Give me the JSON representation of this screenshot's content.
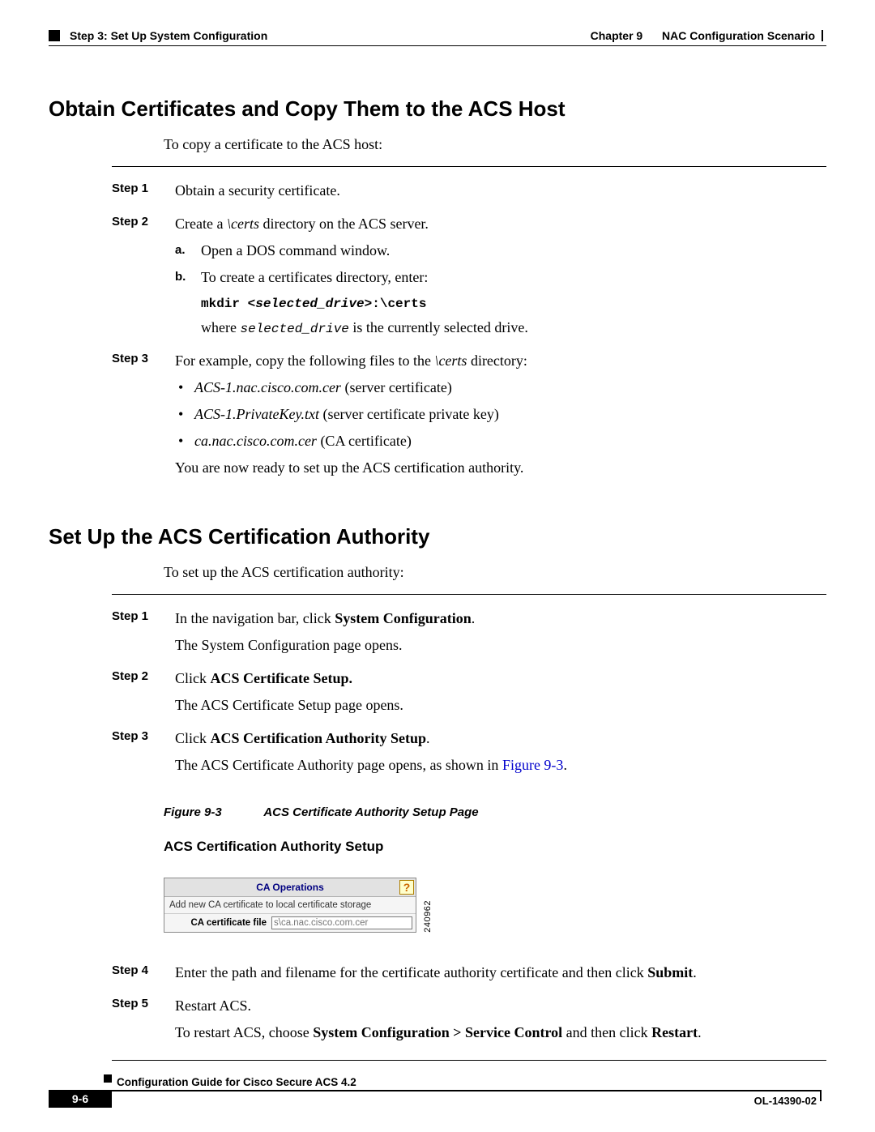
{
  "header": {
    "left": "Step 3: Set Up System Configuration",
    "chapter": "Chapter 9",
    "chapter_title": "NAC Configuration Scenario"
  },
  "section1": {
    "title": "Obtain Certificates and Copy Them to the ACS Host",
    "intro": "To copy a certificate to the ACS host:",
    "step1_label": "Step 1",
    "step1_text": "Obtain a security certificate.",
    "step2_label": "Step 2",
    "step2_text_pre": "Create a ",
    "step2_certs": "\\certs",
    "step2_text_post": " directory on the ACS server.",
    "step2a_letter": "a.",
    "step2a_text": "Open a DOS command window.",
    "step2b_letter": "b.",
    "step2b_text": "To create a certificates directory, enter:",
    "step2b_cmd_pre": "mkdir <",
    "step2b_cmd_it": "selected_drive",
    "step2b_cmd_post": ">:\\certs",
    "step2b_where_pre": "where ",
    "step2b_where_it": "selected_drive",
    "step2b_where_post": " is the currently selected drive.",
    "step3_label": "Step 3",
    "step3_text_pre": "For example, copy the following files to the ",
    "step3_certs": "\\certs",
    "step3_text_post": " directory:",
    "step3_b1_it": "ACS-1.nac.cisco.com.cer",
    "step3_b1_rest": " (server certificate)",
    "step3_b2_it": "ACS-1.PrivateKey.txt",
    "step3_b2_rest": " (server certificate private key)",
    "step3_b3_it": "ca.nac.cisco.com.cer",
    "step3_b3_rest": " (CA certificate)",
    "step3_ready": "You are now ready to set up the ACS certification authority."
  },
  "section2": {
    "title": "Set Up the ACS Certification Authority",
    "intro": "To set up the ACS certification authority:",
    "step1_label": "Step 1",
    "step1_pre": "In the navigation bar, click ",
    "step1_bold": "System Configuration",
    "step1_post": ".",
    "step1_result": "The System Configuration page opens.",
    "step2_label": "Step 2",
    "step2_pre": "Click ",
    "step2_bold": "ACS Certificate Setup.",
    "step2_result": "The ACS Certificate Setup page opens.",
    "step3_label": "Step 3",
    "step3_pre": "Click ",
    "step3_bold": "ACS Certification Authority Setup",
    "step3_post": ".",
    "step3_result_pre": "The ACS Certificate Authority page opens, as shown in ",
    "step3_link": "Figure 9-3",
    "step3_result_post": ".",
    "fig_no": "Figure 9-3",
    "fig_title": "ACS Certificate Authority Setup Page",
    "ui_heading": "ACS Certification Authority Setup",
    "ui_panel_title": "CA Operations",
    "ui_desc": "Add new CA certificate to local certificate storage",
    "ui_field_label": "CA certificate file",
    "ui_field_value": "s\\ca.nac.cisco.com.cer",
    "ui_image_id": "240962",
    "step4_label": "Step 4",
    "step4_pre": "Enter the path and filename for the certificate authority certificate and then click ",
    "step4_bold": "Submit",
    "step4_post": ".",
    "step5_label": "Step 5",
    "step5_text": "Restart ACS.",
    "step5_restart_pre": "To restart ACS, choose ",
    "step5_restart_b1": "System Configuration > Service Control",
    "step5_restart_mid": " and then click ",
    "step5_restart_b2": "Restart",
    "step5_restart_post": "."
  },
  "footer": {
    "guide": "Configuration Guide for Cisco Secure ACS 4.2",
    "page": "9-6",
    "docid": "OL-14390-02"
  }
}
